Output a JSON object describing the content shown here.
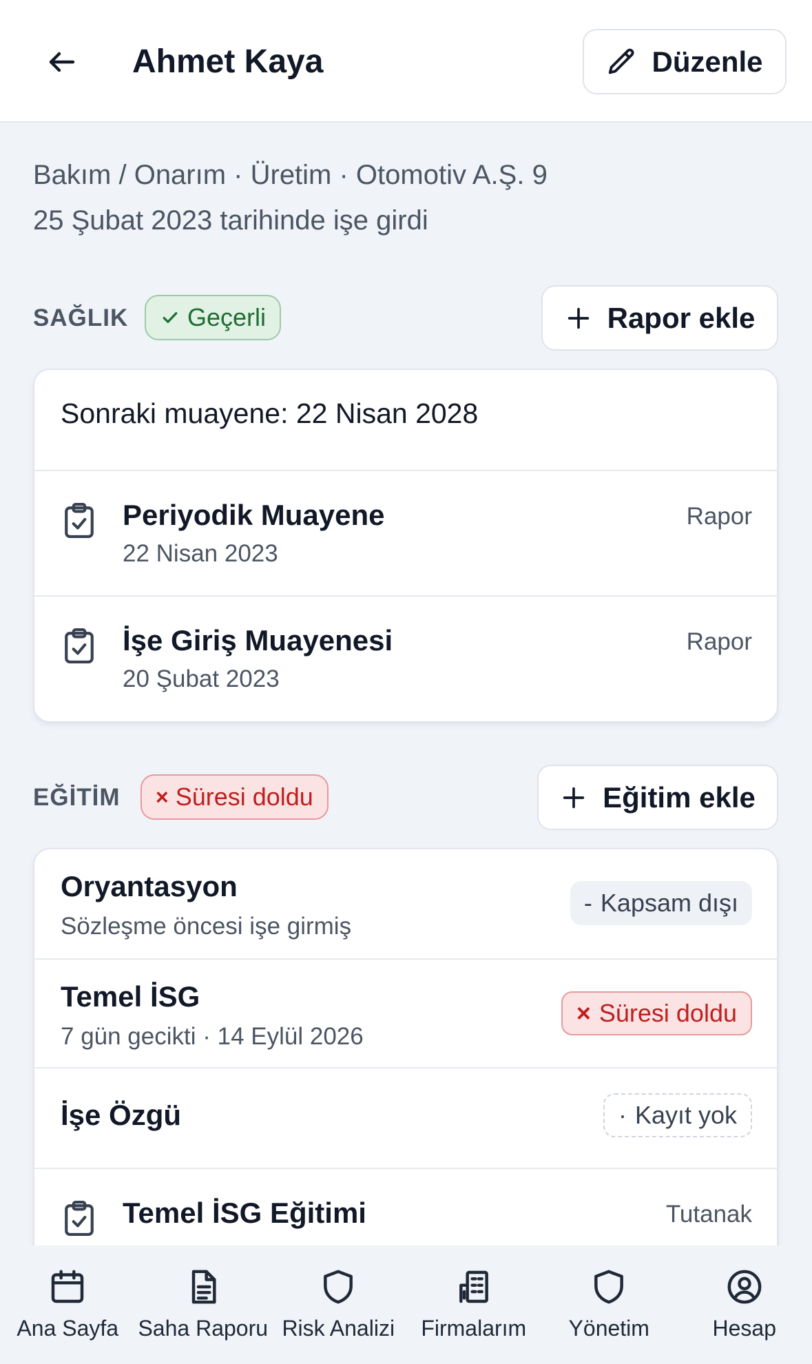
{
  "header": {
    "title": "Ahmet Kaya",
    "edit_label": "Düzenle"
  },
  "meta": {
    "line1": "Bakım / Onarım · Üretim · Otomotiv A.Ş. 9",
    "line2": "25 Şubat 2023 tarihinde işe girdi"
  },
  "health": {
    "label": "SAĞLIK",
    "status": "Geçerli",
    "status_icon": "check-icon",
    "add_label": "Rapor ekle",
    "next_exam": "Sonraki muayene: 22 Nisan 2028",
    "records": [
      {
        "title": "Periyodik Muayene",
        "date": "22 Nisan 2023",
        "link": "Rapor",
        "icon": "clipboard-check-icon"
      },
      {
        "title": "İşe Giriş Muayenesi",
        "date": "20 Şubat 2023",
        "link": "Rapor",
        "icon": "clipboard-check-icon"
      }
    ]
  },
  "training": {
    "label": "EĞİTİM",
    "status": "Süresi doldu",
    "status_icon": "x-icon",
    "add_label": "Eğitim ekle",
    "items": [
      {
        "title": "Oryantasyon",
        "sub": "Sözleşme öncesi işe girmiş",
        "badge": "Kapsam dışı",
        "badge_prefix": "-"
      },
      {
        "title": "Temel İSG",
        "sub": "7 gün gecikti · 14 Eylül 2026",
        "badge": "Süresi doldu",
        "badge_prefix": "×"
      },
      {
        "title": "İşe Özgü",
        "badge": "Kayıt yok",
        "badge_prefix": "·"
      }
    ],
    "record": {
      "title": "Temel İSG Eğitimi",
      "link": "Tutanak",
      "icon": "clipboard-check-icon"
    }
  },
  "nav": [
    {
      "label": "Ana Sayfa",
      "icon": "calendar-icon"
    },
    {
      "label": "Saha Raporu",
      "icon": "document-icon"
    },
    {
      "label": "Risk Analizi",
      "icon": "shield-icon"
    },
    {
      "label": "Firmalarım",
      "icon": "building-icon"
    },
    {
      "label": "Yönetim",
      "icon": "shield-icon"
    },
    {
      "label": "Hesap",
      "icon": "user-circle-icon"
    }
  ],
  "colors": {
    "accent_ok": "#1f6d32",
    "accent_bad": "#c01e1e",
    "background": "#f0f3f8"
  }
}
